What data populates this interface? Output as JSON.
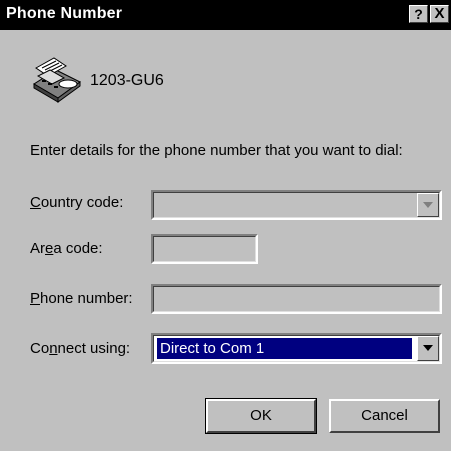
{
  "window": {
    "title": "Phone Number",
    "help_label": "?",
    "close_label": "X"
  },
  "connection": {
    "icon": "phone-fax-icon",
    "name": "1203-GU6"
  },
  "instruction": "Enter details for the phone number that you want to dial:",
  "form": {
    "country_code": {
      "label_prefix": "",
      "label_access": "C",
      "label_rest": "ountry code:",
      "value": "",
      "enabled": false
    },
    "area_code": {
      "label_prefix": "Ar",
      "label_access": "e",
      "label_rest": "a code:",
      "value": ""
    },
    "phone_number": {
      "label_prefix": "",
      "label_access": "P",
      "label_rest": "hone number:",
      "value": ""
    },
    "connect_using": {
      "label_prefix": "Co",
      "label_access": "n",
      "label_rest": "nect using:",
      "value": "Direct to Com 1"
    }
  },
  "buttons": {
    "ok": "OK",
    "cancel": "Cancel"
  },
  "colors": {
    "face": "#c0c0c0",
    "titlebar": "#000000",
    "selection": "#000080"
  }
}
